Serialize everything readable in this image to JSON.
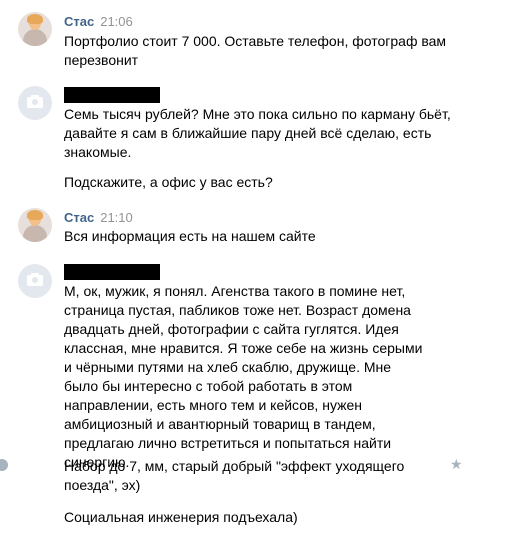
{
  "messages": [
    {
      "author": "Стас",
      "time": "21:06",
      "paragraphs": [
        "Портфолио стоит 7 000. Оставьте телефон, фотограф вам перезвонит"
      ]
    },
    {
      "paragraphs": [
        "Семь тысяч рублей? Мне это пока сильно по карману бьёт, давайте я сам в ближайшие пару дней всё сделаю, есть знакомые.",
        "Подскажите, а офис у вас есть?"
      ]
    },
    {
      "author": "Стас",
      "time": "21:10",
      "paragraphs": [
        "Вся информация есть на нашем сайте"
      ]
    },
    {
      "paragraphs": [
        "М, ок, мужик, я понял. Агенства такого в помине нет, страница пустая, пабликов тоже нет. Возраст домена двадцать дней, фотографии с сайта гуглятся. Идея классная, мне нравится. Я тоже себе на жизнь серыми и чёрными путями на хлеб скаблю, дружище. Мне было бы интересно с тобой работать в этом направлении, есть много тем и кейсов, нужен амбициозный и авантюрный товарищ в тандем, предлагаю лично встретиться и попытаться найти синергию.",
        "Набор до 7, мм, старый добрый \"эффект уходящего поезда\", эх)",
        "Социальная инженерия подъехала)"
      ]
    }
  ]
}
